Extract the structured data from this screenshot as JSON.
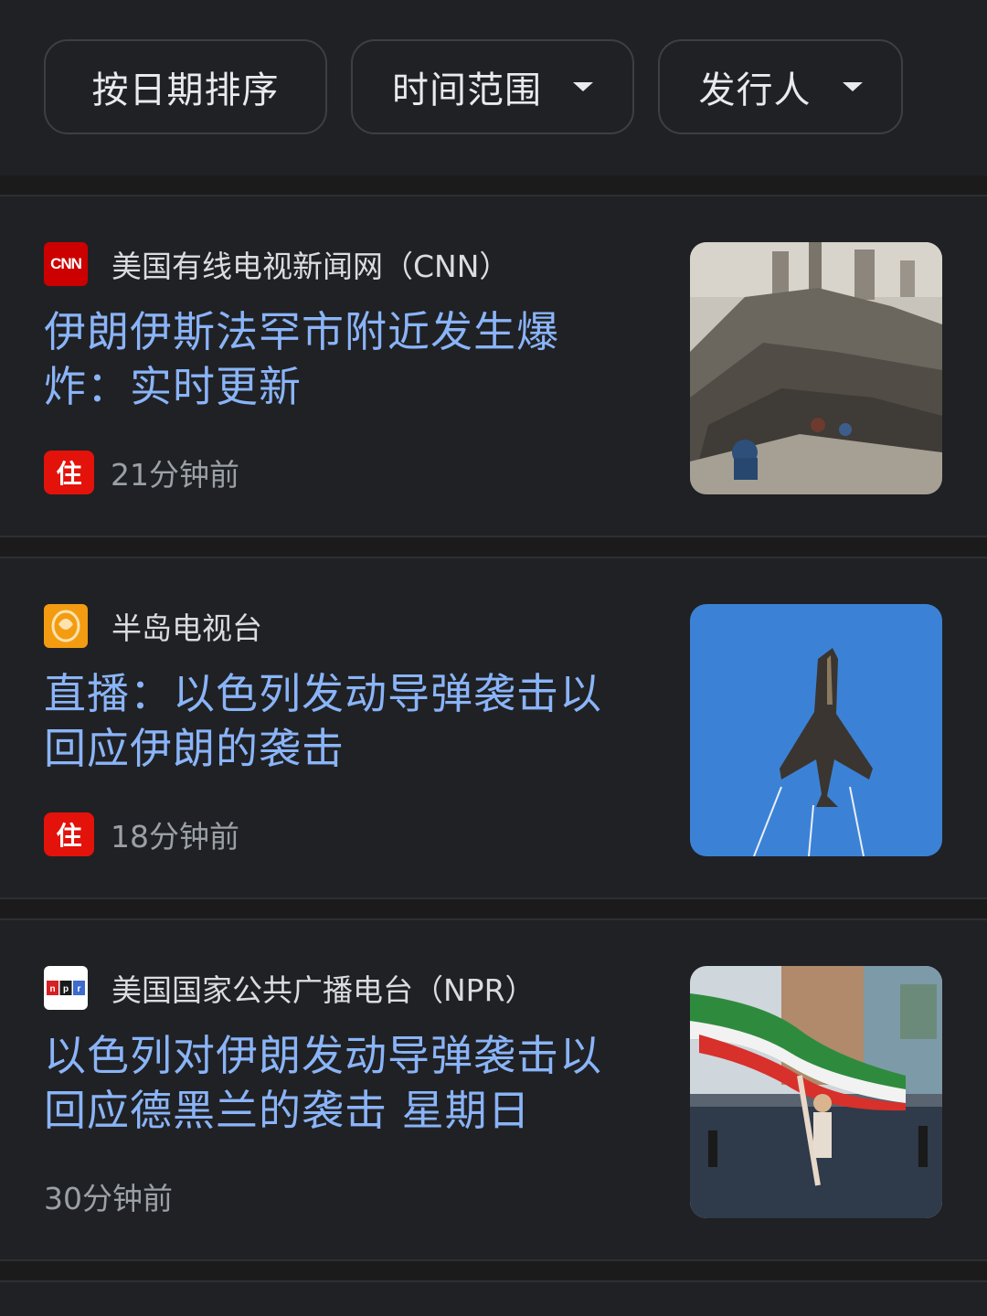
{
  "filters": {
    "sort_label": "按日期排序",
    "time_range_label": "时间范围",
    "publisher_label": "发行人"
  },
  "articles": [
    {
      "source": "美国有线电视新闻网（CNN）",
      "logo_text": "CNN",
      "headline": "伊朗伊斯法罕市附近发生爆炸：实时更新",
      "badge": "住",
      "time": "21分钟前",
      "thumbnail": "rubble-photo"
    },
    {
      "source": "半岛电视台",
      "logo_text": "",
      "headline": "直播：以色列发动导弹袭击以回应伊朗的袭击",
      "badge": "住",
      "time": "18分钟前",
      "thumbnail": "fighter-jet-photo"
    },
    {
      "source": "美国国家公共广播电台（NPR）",
      "logo_text": "npr",
      "headline": "以色列对伊朗发动导弹袭击以回应德黑兰的袭击 星期日",
      "badge": "",
      "time": "30分钟前",
      "thumbnail": "flag-street-photo"
    }
  ],
  "colors": {
    "background": "#202124",
    "headline": "#8ab4f8",
    "live_badge": "#e3120b",
    "cnn_red": "#cc0000",
    "aljazeera_orange": "#f39c12"
  }
}
